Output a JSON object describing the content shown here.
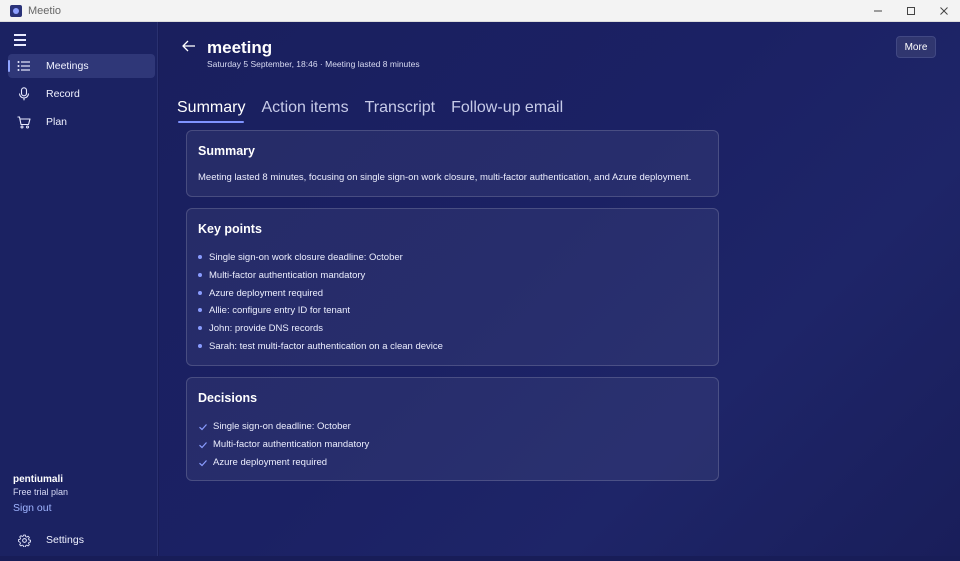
{
  "window": {
    "app_title": "Meetio"
  },
  "sidebar": {
    "items": [
      {
        "label": "Meetings",
        "icon": "list-icon",
        "active": true
      },
      {
        "label": "Record",
        "icon": "microphone-icon",
        "active": false
      },
      {
        "label": "Plan",
        "icon": "cart-icon",
        "active": false
      }
    ],
    "user": {
      "name": "pentiumali",
      "plan": "Free trial plan"
    },
    "sign_out_label": "Sign out",
    "settings_label": "Settings"
  },
  "header": {
    "title": "meeting",
    "subtitle": "Saturday 5 September, 18:46 · Meeting lasted 8 minutes",
    "more_label": "More"
  },
  "tabs": [
    {
      "label": "Summary",
      "active": true
    },
    {
      "label": "Action items",
      "active": false
    },
    {
      "label": "Transcript",
      "active": false
    },
    {
      "label": "Follow-up email",
      "active": false
    }
  ],
  "summary": {
    "title": "Summary",
    "text": "Meeting lasted 8 minutes, focusing on single sign-on work closure, multi-factor authentication, and Azure deployment."
  },
  "key_points": {
    "title": "Key points",
    "items": [
      "Single sign-on work closure deadline: October",
      "Multi-factor authentication mandatory",
      "Azure deployment required",
      "Allie: configure entry ID for tenant",
      "John: provide DNS records",
      "Sarah: test multi-factor authentication on a clean device"
    ]
  },
  "decisions": {
    "title": "Decisions",
    "items": [
      "Single sign-on deadline: October",
      "Multi-factor authentication mandatory",
      "Azure deployment required"
    ]
  },
  "colors": {
    "accent": "#7f93ff",
    "background": "#181d58",
    "sidebar": "#1b2262",
    "link": "#9fb4ff"
  }
}
